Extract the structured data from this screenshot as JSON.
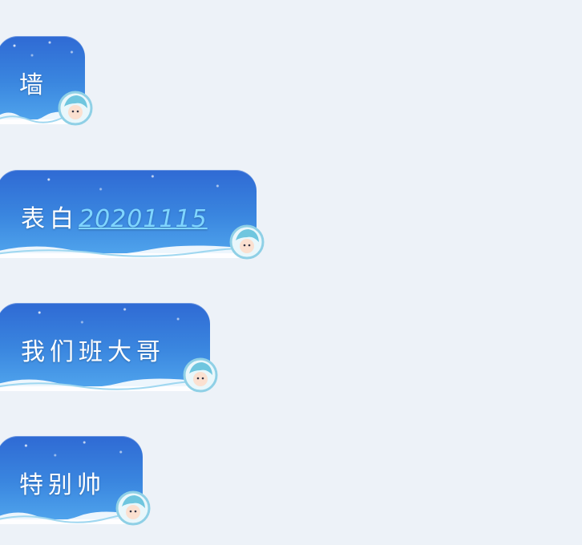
{
  "messages": [
    {
      "text": "墙",
      "link": ""
    },
    {
      "text": "表白",
      "link": "20201115"
    },
    {
      "text": "我们班大哥",
      "link": ""
    },
    {
      "text": "特别帅",
      "link": ""
    }
  ],
  "theme": {
    "background": "#edf2f8",
    "bubble_top": "#2f6ad4",
    "bubble_bottom": "#4fa3ec",
    "link_color": "#7fd6ff"
  },
  "icons": {
    "bubble_decoration": "mascot-icon",
    "wave": "wave-icon"
  }
}
